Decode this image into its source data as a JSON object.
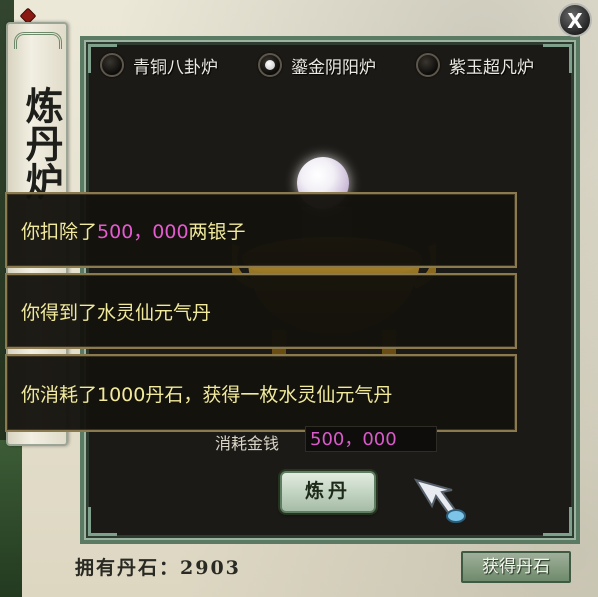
{
  "window": {
    "banner_title": "炼丹炉",
    "close_label": "X"
  },
  "furnaces": [
    {
      "label": "青铜八卦炉",
      "selected": false
    },
    {
      "label": "鎏金阴阳炉",
      "selected": true
    },
    {
      "label": "紫玉超凡炉",
      "selected": false
    }
  ],
  "messages": {
    "m1_prefix": "你扣除了",
    "m1_amount": "500，000",
    "m1_suffix": "两银子",
    "m2": "你得到了水灵仙元气丹",
    "m3": "你消耗了1000丹石，获得一枚水灵仙元气丹"
  },
  "cost": {
    "label": "消耗金钱",
    "value": "500，000"
  },
  "actions": {
    "refine_label": "炼丹",
    "get_stone_label": "获得丹石"
  },
  "owned": {
    "label": "拥有丹石：",
    "value": "2903"
  },
  "colors": {
    "message_text": "#f1ea9c",
    "money_highlight": "#e45bd0",
    "frame_green": "#5b7a64"
  }
}
